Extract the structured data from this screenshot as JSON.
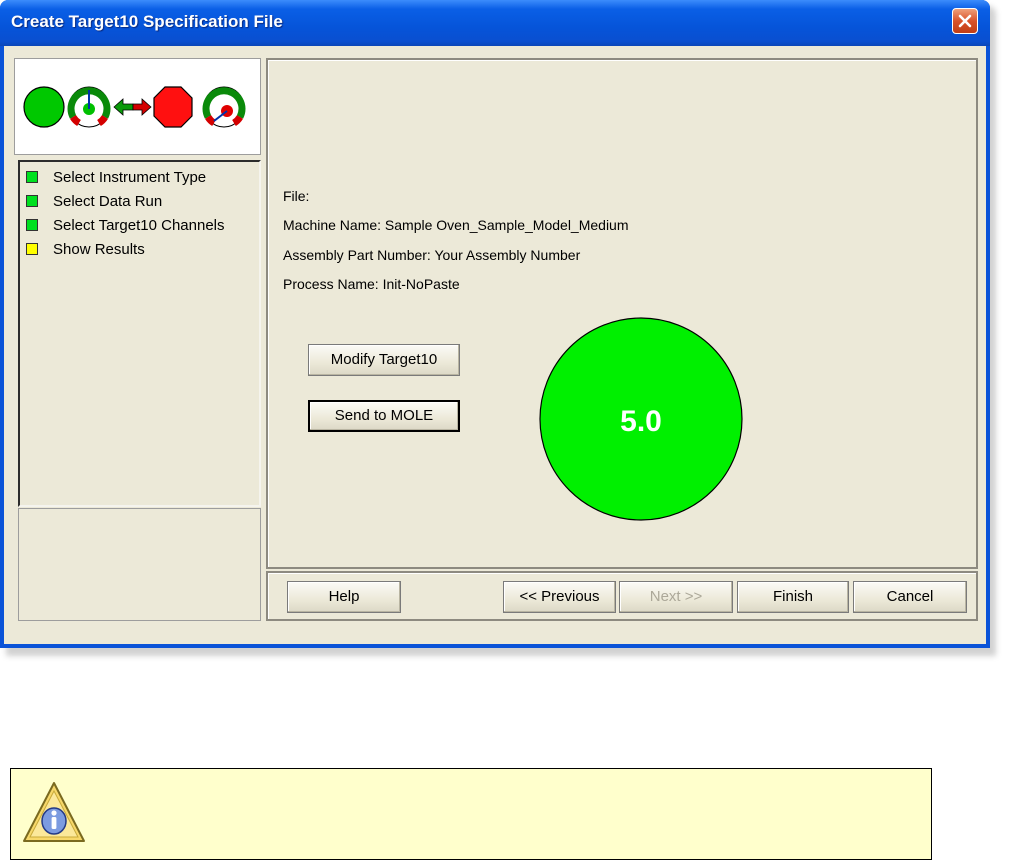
{
  "window": {
    "title": "Create Target10 Specification File"
  },
  "steps": [
    {
      "label": "Select Instrument Type",
      "color": "#00e020"
    },
    {
      "label": "Select Data Run",
      "color": "#00e020"
    },
    {
      "label": "Select Target10 Channels",
      "color": "#00e020"
    },
    {
      "label": "Show Results",
      "color": "#ffff00"
    }
  ],
  "info": {
    "file": "File:",
    "machine_name": "Machine Name: Sample Oven_Sample_Model_Medium",
    "assembly_part_number": "Assembly Part Number: Your Assembly Number",
    "process_name": "Process Name: Init-NoPaste"
  },
  "actions": {
    "modify_label": "Modify Target10",
    "send_label": "Send to MOLE"
  },
  "result": {
    "score": "5.0",
    "color": "#00f000"
  },
  "footer": {
    "help": "Help",
    "previous": "<< Previous",
    "next": "Next >>",
    "finish": "Finish",
    "cancel": "Cancel"
  },
  "colors": {
    "title_bar": "#0654d9",
    "status_go": "#00c800",
    "status_stop": "#ff0000"
  },
  "icons": {
    "close": "close-icon",
    "wizard_banner": [
      "green-circle-icon",
      "gauge-good-icon",
      "swap-arrows-icon",
      "stop-sign-icon",
      "gauge-bad-icon"
    ],
    "note": "info-warning-icon"
  }
}
